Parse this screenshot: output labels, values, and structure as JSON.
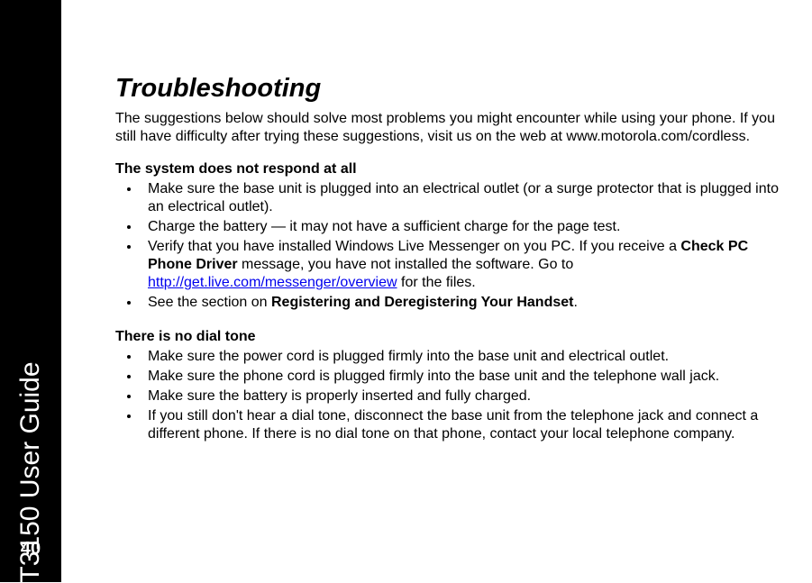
{
  "sidebar": {
    "doc_title": "T3150 User Guide",
    "page_number": "40"
  },
  "title": "Troubleshooting",
  "intro": "The suggestions below should solve most problems you might encounter while using your phone. If you still have difficulty after trying these suggestions, visit us on the web at www.motorola.com/cordless.",
  "sections": [
    {
      "heading": "The system does not respond at all",
      "items": [
        {
          "pre": "Make sure the base unit is plugged into an electrical outlet (or a surge protector that is plugged into an electrical outlet)."
        },
        {
          "pre": "Charge the battery — it may not have a sufficient charge for the page test."
        },
        {
          "pre": "Verify that you have installed Windows Live Messenger on you PC. If you receive a ",
          "bold": "Check PC Phone Driver",
          "mid": " message, you have not installed the software. Go to ",
          "link": "http://get.live.com/messenger/overview",
          "post": " for the files."
        },
        {
          "pre": "See the section on ",
          "bold": "Registering and Deregistering Your Handset",
          "post": "."
        }
      ]
    },
    {
      "heading": "There is no dial tone",
      "items": [
        {
          "pre": "Make sure the power cord is plugged firmly into the base unit and electrical outlet."
        },
        {
          "pre": "Make sure the phone cord is plugged firmly into the base unit and the telephone wall jack."
        },
        {
          "pre": "Make sure the battery is properly inserted and fully charged."
        },
        {
          "pre": "If you still don't hear a dial tone, disconnect the base unit from the telephone jack and connect a different phone. If there is no dial tone on that phone, contact your local telephone company."
        }
      ]
    }
  ]
}
